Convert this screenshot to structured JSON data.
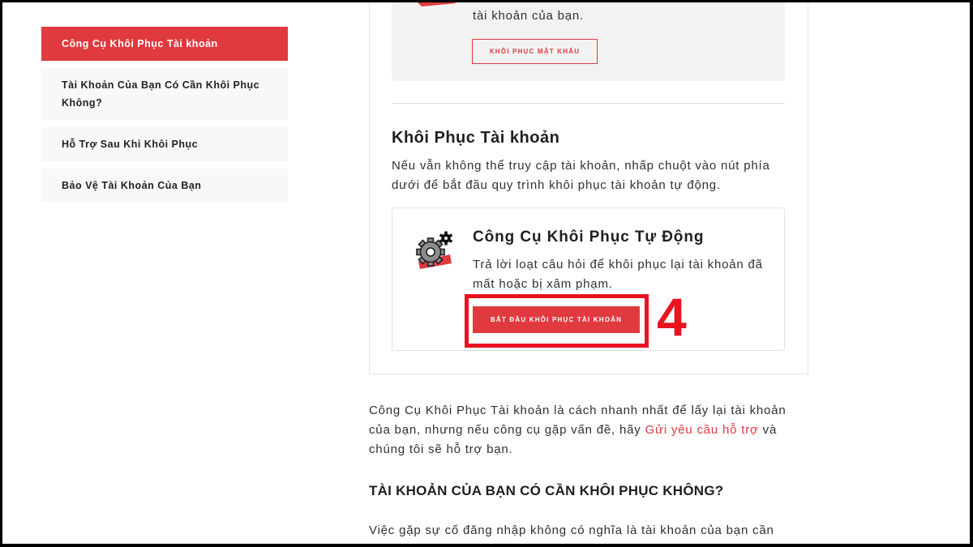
{
  "colors": {
    "brand_red": "#e03a3f",
    "annotation_red": "#e9121f",
    "body_text": "#303030",
    "panel_gray": "#f2f2f2",
    "nav_item_gray": "#f8f8f8"
  },
  "sidebar": {
    "items": [
      {
        "label": "Công Cụ Khôi Phục Tài khoản",
        "active": true
      },
      {
        "label": "Tài Khoản Của Bạn Có Cần Khôi Phục Không?",
        "active": false
      },
      {
        "label": "Hỗ Trợ Sau Khi Khôi Phục",
        "active": false
      },
      {
        "label": "Bảo Vệ Tài Khoản Của Bạn",
        "active": false
      }
    ]
  },
  "password_panel": {
    "icon": "red-brush-icon",
    "text": "tài khoản của bạn.",
    "button_label": "KHÔI PHỤC MẬT KHẨU"
  },
  "recovery_section": {
    "heading": "Khôi Phục Tài khoản",
    "description_lines": [
      "Nếu vẫn không thể truy cập tài khoản, nhấp chuột vào nút phía",
      "dưới để bắt đầu quy trình khôi phục tài khoản tự động."
    ],
    "tool_card": {
      "icon": "gear-icon",
      "title": "Công Cụ Khôi Phục Tự Động",
      "description_lines": [
        "Trả lời loạt câu hỏi để khôi phục lại tài khoản đã",
        "mất hoặc bị xâm phạm."
      ],
      "button_label": "BẮT ĐẦU KHÔI PHỤC TÀI KHOẢN"
    }
  },
  "annotation": {
    "step_number": "4"
  },
  "intro_paragraph": {
    "line1": "Công Cụ Khôi Phục Tài khoản là cách nhanh nhất để lấy lại tài khoản",
    "line2_before_link": "của bạn, nhưng nếu công cụ gặp vấn đề, hãy ",
    "support_link": "Gửi yêu cầu hỗ trợ",
    "line2_after_link": " và",
    "line3": "chúng tôi sẽ hỗ trợ bạn."
  },
  "faq_section": {
    "heading": "TÀI KHOẢN CỦA BẠN CÓ CẦN KHÔI PHỤC KHÔNG?",
    "paragraph_first_line": "Việc gặp sự cố đăng nhập không có nghĩa là tài khoản của bạn cần"
  }
}
